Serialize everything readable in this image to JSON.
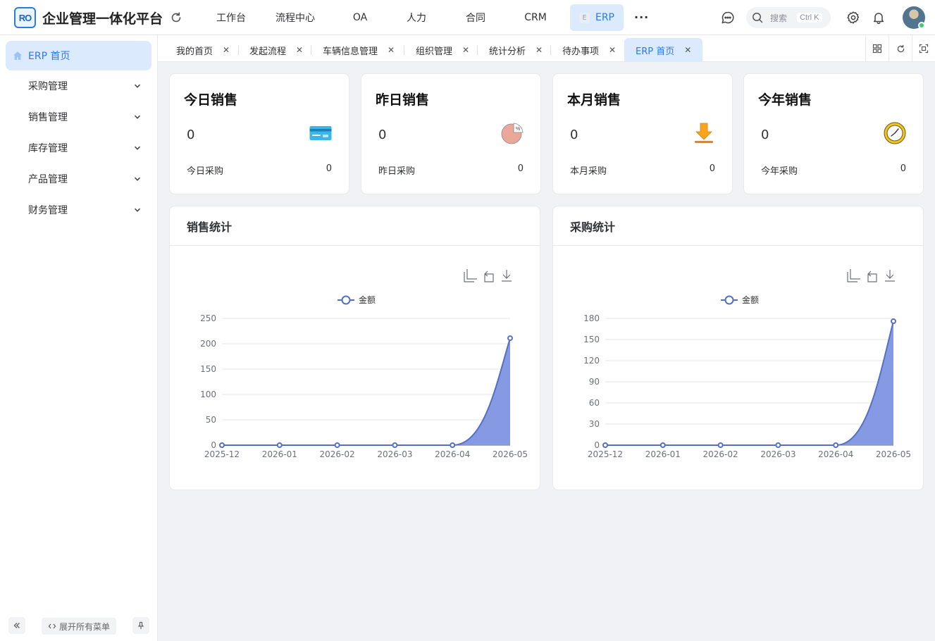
{
  "app": {
    "logo_text": "RO",
    "title": "企业管理一体化平台"
  },
  "topnav": [
    {
      "label": "工作台",
      "active": false
    },
    {
      "label": "流程中心",
      "active": false
    },
    {
      "label": "OA",
      "active": false
    },
    {
      "label": "人力",
      "active": false
    },
    {
      "label": "合同",
      "active": false
    },
    {
      "label": "CRM",
      "active": false
    },
    {
      "label": "ERP",
      "active": true
    }
  ],
  "header": {
    "more": "···",
    "search_placeholder": "搜索",
    "search_shortcut": "Ctrl K"
  },
  "sidebar": {
    "home": "ERP 首页",
    "items": [
      {
        "label": "采购管理"
      },
      {
        "label": "销售管理"
      },
      {
        "label": "库存管理"
      },
      {
        "label": "产品管理"
      },
      {
        "label": "财务管理"
      }
    ],
    "expand_all": "展开所有菜单"
  },
  "tabs": [
    {
      "label": "我的首页",
      "active": false
    },
    {
      "label": "发起流程",
      "active": false
    },
    {
      "label": "车辆信息管理",
      "active": false
    },
    {
      "label": "组织管理",
      "active": false
    },
    {
      "label": "统计分析",
      "active": false
    },
    {
      "label": "待办事项",
      "active": false
    },
    {
      "label": "ERP 首页",
      "active": true
    }
  ],
  "stats": [
    {
      "title": "今日销售",
      "value": "0",
      "sub_label": "今日采购",
      "sub_value": "0",
      "icon": "credit-card-icon"
    },
    {
      "title": "昨日销售",
      "value": "0",
      "sub_label": "昨日采购",
      "sub_value": "0",
      "icon": "pie-chart-icon"
    },
    {
      "title": "本月销售",
      "value": "0",
      "sub_label": "本月采购",
      "sub_value": "0",
      "icon": "download-icon"
    },
    {
      "title": "今年销售",
      "value": "0",
      "sub_label": "今年采购",
      "sub_value": "0",
      "icon": "clock-icon"
    }
  ],
  "chart_data": [
    {
      "type": "area",
      "title": "销售统计",
      "legend": "金额",
      "x": [
        "2025-12",
        "2026-01",
        "2026-02",
        "2026-03",
        "2026-04",
        "2026-05"
      ],
      "values": [
        0,
        0,
        0,
        0,
        0,
        211
      ],
      "yticks": [
        0,
        50,
        100,
        150,
        200,
        250
      ],
      "ylim": [
        0,
        250
      ],
      "color": "#5470c6",
      "fill": "#8095e3",
      "grid": true,
      "legend_position": "top-center"
    },
    {
      "type": "area",
      "title": "采购统计",
      "legend": "金额",
      "x": [
        "2025-12",
        "2026-01",
        "2026-02",
        "2026-03",
        "2026-04",
        "2026-05"
      ],
      "values": [
        0,
        0,
        0,
        0,
        0,
        176
      ],
      "yticks": [
        0,
        30,
        60,
        90,
        120,
        150,
        180
      ],
      "ylim": [
        0,
        180
      ],
      "color": "#5470c6",
      "fill": "#8095e3",
      "grid": true,
      "legend_position": "top-center"
    }
  ]
}
